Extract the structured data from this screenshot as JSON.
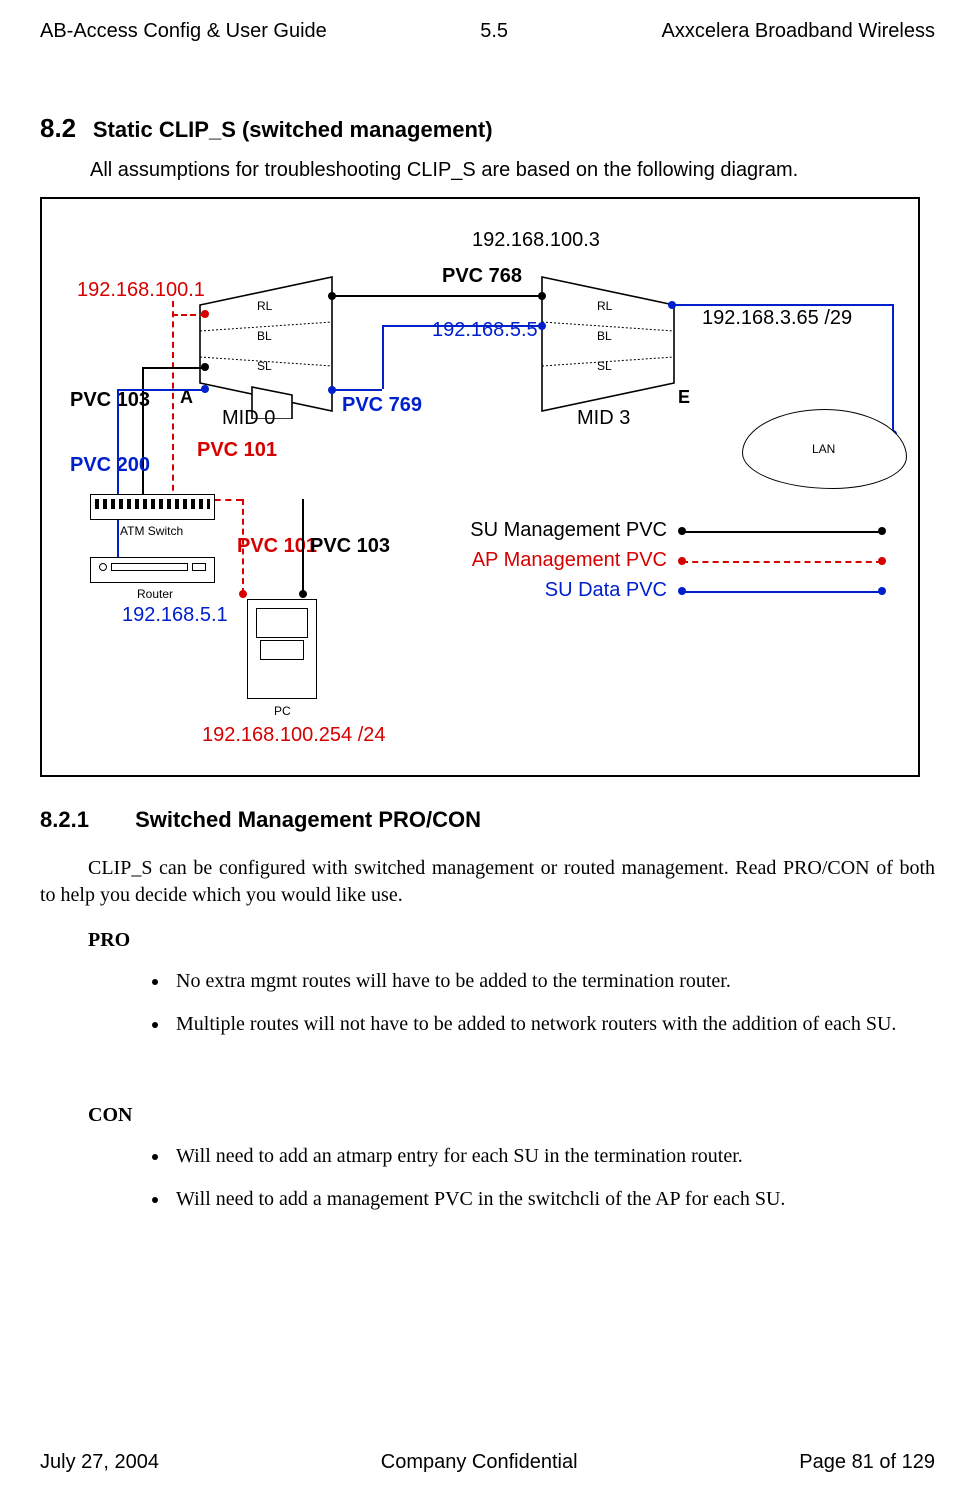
{
  "header": {
    "left": "AB-Access Config & User Guide",
    "center": "5.5",
    "right": "Axxcelera Broadband Wireless"
  },
  "footer": {
    "left": "July 27, 2004",
    "center": "Company Confidential",
    "right": "Page 81 of 129"
  },
  "section": {
    "number": "8.2",
    "title": "Static CLIP_S (switched management)",
    "intro": "All assumptions for troubleshooting CLIP_S are based on the following diagram."
  },
  "diagram": {
    "ip_ap_rl": "192.168.100.1",
    "ip_su_top": "192.168.100.3",
    "ip_su_data": "192.168.5.5",
    "ip_lan": "192.168.3.65 /29",
    "ip_router": "192.168.5.1",
    "ip_pc": "192.168.100.254 /24",
    "pvc_768": "PVC 768",
    "pvc_769": "PVC 769",
    "pvc_103_left": "PVC 103",
    "pvc_200": "PVC 200",
    "pvc_101_top": "PVC 101",
    "pvc_101_bottom": "PVC 101",
    "pvc_103_right": "PVC 103",
    "letter_a": "A",
    "letter_e": "E",
    "mid0": "MID 0",
    "mid3": "MID 3",
    "rl": "RL",
    "bl": "BL",
    "sl": "SL",
    "atm_switch": "ATM Switch",
    "router": "Router",
    "pc": "PC",
    "lan": "LAN",
    "legend": {
      "su_mgmt": "SU Management PVC",
      "ap_mgmt": "AP Management PVC",
      "su_data": "SU Data PVC"
    }
  },
  "subsection": {
    "number": "8.2.1",
    "title": "Switched Management PRO/CON",
    "para": "CLIP_S can be configured with switched management or routed management. Read PRO/CON of both to help you decide which you would like use.",
    "pro_label": "PRO",
    "con_label": "CON",
    "pro": [
      "No extra mgmt routes will have to be added to the termination router.",
      "Multiple routes will not have to be added to network routers with the addition of each SU."
    ],
    "con": [
      "Will need to add an atmarp entry for each SU in the termination router.",
      "Will need to add a management PVC in the switchcli of the AP for each SU."
    ]
  }
}
